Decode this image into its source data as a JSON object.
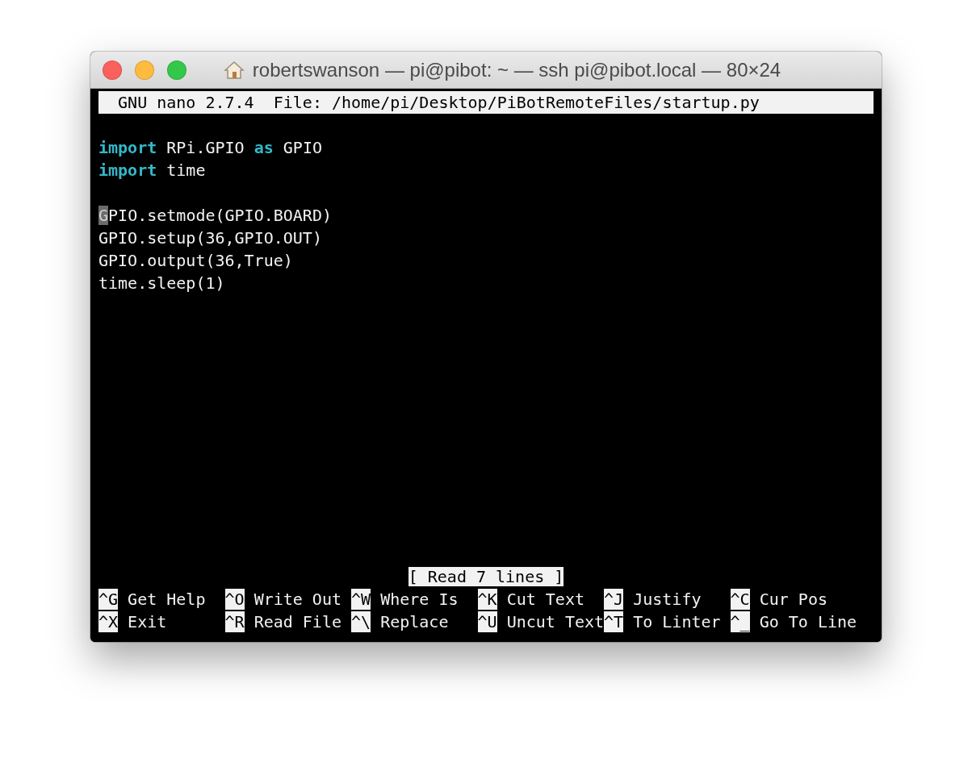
{
  "window": {
    "title": "robertswanson — pi@pibot: ~ — ssh pi@pibot.local — 80×24"
  },
  "nano_header": {
    "version": "GNU nano 2.7.4",
    "file": "File: /home/pi/Desktop/PiBotRemoteFiles/startup.py"
  },
  "lines": [
    {
      "kind": "blank"
    },
    {
      "kind": "code",
      "segments": [
        {
          "text": "import",
          "kind": "keyword"
        },
        {
          "text": " RPi.GPIO ",
          "kind": "plain"
        },
        {
          "text": "as",
          "kind": "keyword"
        },
        {
          "text": " GPIO",
          "kind": "plain"
        }
      ]
    },
    {
      "kind": "code",
      "segments": [
        {
          "text": "import",
          "kind": "keyword"
        },
        {
          "text": " time",
          "kind": "plain"
        }
      ]
    },
    {
      "kind": "blank"
    },
    {
      "kind": "code",
      "segments": [
        {
          "text": "G",
          "kind": "cursor"
        },
        {
          "text": "PIO.setmode(GPIO.BOARD)",
          "kind": "plain"
        }
      ]
    },
    {
      "kind": "code",
      "segments": [
        {
          "text": "GPIO.setup(36,GPIO.OUT)",
          "kind": "plain"
        }
      ]
    },
    {
      "kind": "code",
      "segments": [
        {
          "text": "GPIO.output(36,True)",
          "kind": "plain"
        }
      ]
    },
    {
      "kind": "code",
      "segments": [
        {
          "text": "time.sleep(1)",
          "kind": "plain"
        }
      ]
    }
  ],
  "status": "[ Read 7 lines ]",
  "shortcuts": [
    [
      {
        "key": "^G",
        "label": "Get Help"
      },
      {
        "key": "^O",
        "label": "Write Out"
      },
      {
        "key": "^W",
        "label": "Where Is"
      },
      {
        "key": "^K",
        "label": "Cut Text"
      },
      {
        "key": "^J",
        "label": "Justify"
      },
      {
        "key": "^C",
        "label": "Cur Pos"
      }
    ],
    [
      {
        "key": "^X",
        "label": "Exit"
      },
      {
        "key": "^R",
        "label": "Read File"
      },
      {
        "key": "^\\",
        "label": "Replace"
      },
      {
        "key": "^U",
        "label": "Uncut Text"
      },
      {
        "key": "^T",
        "label": "To Linter"
      },
      {
        "key": "^_",
        "label": "Go To Line"
      }
    ]
  ]
}
